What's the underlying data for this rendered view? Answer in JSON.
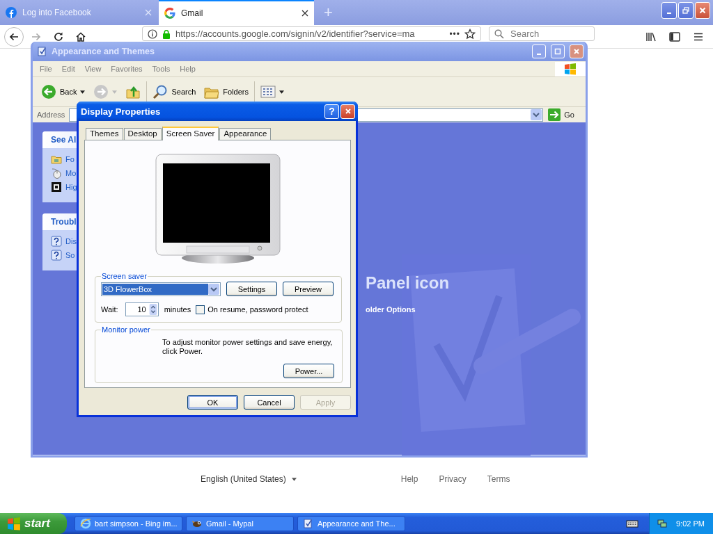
{
  "browser": {
    "tabs": [
      {
        "label": "Log into Facebook",
        "selected": false
      },
      {
        "label": "Gmail",
        "selected": true
      }
    ],
    "new_tab": "+",
    "url": "https://accounts.google.com/signin/v2/identifier?service=ma",
    "page_actions": "•••",
    "search": {
      "placeholder": "Search"
    }
  },
  "page_footer": {
    "language": "English (United States)",
    "links": [
      "Help",
      "Privacy",
      "Terms"
    ]
  },
  "explorer": {
    "title": "Appearance and Themes",
    "menu": [
      "File",
      "Edit",
      "View",
      "Favorites",
      "Tools",
      "Help"
    ],
    "toolbar": [
      {
        "kind": "back",
        "label": "Back"
      },
      {
        "kind": "forward"
      },
      {
        "kind": "up"
      },
      {
        "kind": "search",
        "label": "Search"
      },
      {
        "kind": "folders",
        "label": "Folders"
      },
      {
        "kind": "views"
      }
    ],
    "address": {
      "label": "Address",
      "go": "Go"
    },
    "panels": [
      {
        "title": "See Al",
        "items": [
          {
            "label": "Fo"
          },
          {
            "label": "Mo"
          },
          {
            "label": "Hig"
          }
        ]
      },
      {
        "title": "Troubl",
        "items": [
          {
            "label": "Dis"
          },
          {
            "label": "So"
          }
        ]
      }
    ],
    "heading": "Panel icon",
    "link": "older Options"
  },
  "dialog": {
    "title": "Display Properties",
    "help": "?",
    "tabs": [
      {
        "label": "Themes",
        "selected": false
      },
      {
        "label": "Desktop",
        "selected": false
      },
      {
        "label": "Screen Saver",
        "selected": true
      },
      {
        "label": "Appearance",
        "selected": false
      }
    ],
    "screen_saver": {
      "group_label": "Screen saver",
      "selected": "3D FlowerBox",
      "settings": "Settings",
      "preview": "Preview",
      "wait_label": "Wait:",
      "wait_value": "10",
      "minutes": "minutes",
      "password": {
        "label": "On resume, password protect",
        "checked": false
      }
    },
    "monitor_power": {
      "group_label": "Monitor power",
      "text": "To adjust monitor power settings and save energy, click Power.",
      "button": "Power..."
    },
    "buttons": [
      {
        "label": "OK",
        "disabled": false
      },
      {
        "label": "Cancel",
        "disabled": false
      },
      {
        "label": "Apply",
        "disabled": true
      }
    ]
  },
  "taskbar": {
    "start": "start",
    "tasks": [
      {
        "label": "bart simpson - Bing im..."
      },
      {
        "label": "Gmail - Mypal"
      },
      {
        "label": "Appearance and The..."
      }
    ],
    "clock": "9:02 PM"
  }
}
